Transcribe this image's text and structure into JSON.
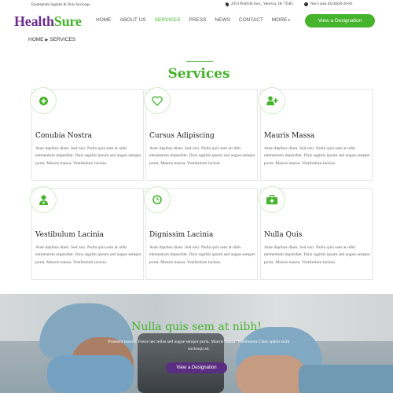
{
  "topbar": {
    "tagline": "Elementum Sagittis & Duis Sociosqu",
    "address": "2053 Polifolil hwy., Venevia, JK 73582",
    "phone": "Nec's area (024)628-26-83"
  },
  "header": {
    "logo_part1": "Health",
    "logo_part2": "Sure",
    "nav": [
      "HOME",
      "ABOUT US",
      "SERVICES",
      "PRESS",
      "NEWS",
      "CONTACT",
      "MORE"
    ],
    "active_nav": "SERVICES",
    "cta": "View a Designation"
  },
  "breadcrumb": {
    "home": "HOME",
    "current": "SERVICES"
  },
  "section": {
    "title": "Services"
  },
  "cards": [
    {
      "title": "Conubia Nostra",
      "icon": "plus-circle-icon",
      "text": "Ante dapibus diam. Sed nisi. Nulla quis sem at nibh elementum imperdiet. Duis sagittis ipsum sed augue semper porta. Mauris massa. Vestibulum lacinia."
    },
    {
      "title": "Cursus Adipiscing",
      "icon": "heart-icon",
      "text": "Ante dapibus diam. Sed nisi. Nulla quis sem at nibh elementum imperdiet. Duis sagittis ipsum sed augue semper porta. Mauris massa. Vestibulum lacinia."
    },
    {
      "title": "Mauris Massa",
      "icon": "add-user-icon",
      "text": "Ante dapibus diam. Sed nisi. Nulla quis sem at nibh elementum imperdiet. Duis sagittis ipsum sed augue semper porta. Mauris massa. Vestibulum lacinia."
    },
    {
      "title": "Vestibulum Lacinia",
      "icon": "doctor-icon",
      "text": "Ante dapibus diam. Sed nisi. Nulla quis sem at nibh elementum imperdiet. Duis sagittis ipsum sed augue semper porta. Mauris massa. Vestibulum lacinia."
    },
    {
      "title": "Dignissim Lacinia",
      "icon": "clock-icon",
      "text": "Ante dapibus diam. Sed nisi. Nulla quis sem at nibh elementum imperdiet. Duis sagittis ipsum sed augue semper porta. Mauris massa. Vestibulum lacinia."
    },
    {
      "title": "Nulla Quis",
      "icon": "first-aid-kit-icon",
      "text": "Ante dapibus diam. Sed nisi. Nulla quis sem at nibh elementum imperdiet. Duis sagittis ipsum sed augue semper porta. Mauris massa. Vestibulum lacinia."
    }
  ],
  "hero": {
    "title": "Nulla quis sem at nibh!",
    "text": "Praesent mauris. Fusce nec tellus sed augue semper porta. Mauris massa. Vestibulum Class aptent taciti sociosqu ad.",
    "button": "View a Designation"
  },
  "colors": {
    "green": "#45b32b",
    "purple": "#5a2d82",
    "logo_purple": "#6b2e8c"
  }
}
